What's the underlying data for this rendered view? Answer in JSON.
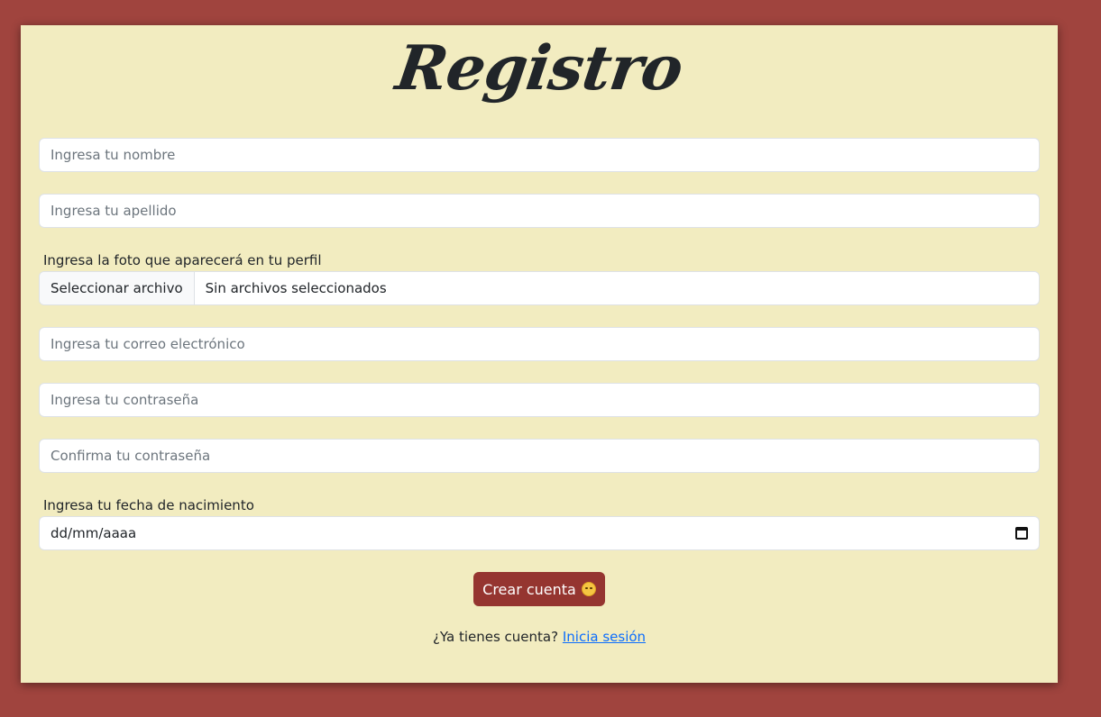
{
  "page": {
    "title": "Registro"
  },
  "form": {
    "first_name": {
      "placeholder": "Ingresa tu nombre",
      "value": ""
    },
    "last_name": {
      "placeholder": "Ingresa tu apellido",
      "value": ""
    },
    "photo": {
      "label": "Ingresa la foto que aparecerá en tu perfil",
      "button_label": "Seleccionar archivo",
      "status_text": "Sin archivos seleccionados"
    },
    "email": {
      "placeholder": "Ingresa tu correo electrónico",
      "value": ""
    },
    "password": {
      "placeholder": "Ingresa tu contraseña",
      "value": ""
    },
    "confirm_password": {
      "placeholder": "Confirma tu contraseña",
      "value": ""
    },
    "birthdate": {
      "label": "Ingresa tu fecha de nacimiento",
      "display_value": "dd/mm/aaaa",
      "icon": "calendar-icon"
    },
    "submit": {
      "label": "Crear cuenta",
      "icon": "winking-face-icon"
    }
  },
  "footer": {
    "prompt": "¿Ya tienes cuenta?",
    "login_link": "Inicia sesión"
  },
  "colors": {
    "background": "#a0443e",
    "card": "#f2ecc0",
    "button": "#953530",
    "link": "#0d6efd"
  }
}
